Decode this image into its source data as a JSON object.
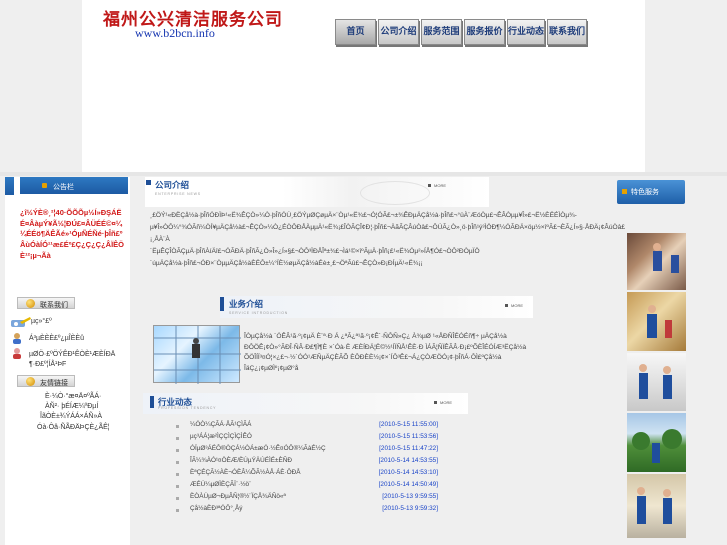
{
  "header": {
    "company_name": "福州公兴清洁服务公司",
    "website": "www.b2bcn.info",
    "nav": [
      {
        "label": "首页"
      },
      {
        "label": "公司介绍"
      },
      {
        "label": "服务范围"
      },
      {
        "label": "服务报价"
      },
      {
        "label": "行业动态"
      },
      {
        "label": "联系我们"
      }
    ]
  },
  "sidebar": {
    "notice_title": "公告栏",
    "notice_text": "¿î½ÝÈ®¸²¦40·ÕÕÕµ½Í»ÐŞÁËÉ¤ÂàµÝ¥Ã½¦ÐÚ£¤ÂÜÉÉ©¤¼¼ÉÉö¶ÄÊÃé»¹ÓµÑÉÑé·þÎñ£ºÂùÓàÍÓ¹¹æ£Éº£Ç¿Ç¿Ç¿ÂÏÊÖÈ¹²¡µ¬Ãà",
    "quick_title": "联系我们",
    "quick_items": [
      {
        "label": "µç»°£º"
      },
      {
        "label": "Á³µÈÈÈ£º¿µÎÈÈû"
      },
      {
        "label": "µØÖ·£ºÖÝÊÐ¹ÊÒÈ¹ÆÈÍÐÄ ¶·Ð£º¦ÍÅ¹ÞF"
      }
    ],
    "links_title": "友情链接",
    "links": [
      {
        "label": "È·¼Ò·°æ¤Ä¤ºÃÁ·"
      },
      {
        "label": "ÀÑ²· þÉÍÆ¼ºÐµÍ"
      },
      {
        "label": "ÎãÒÈ±¾ÝÁÁ×ÁÑ»À"
      },
      {
        "label": "Óà·Ôâ·ÑÃÐÄÞÇÈ¿ÃÊ¦"
      }
    ]
  },
  "about": {
    "title": "公司介绍",
    "subtitle": "ENTERPRISE NEWS",
    "more": "MORE",
    "text": "¸£ÖÝ¹«ÐËÇå½à·þÎñÓÐÏÞ¹«Ë¾ÊÇÒ»¼Ò·þÎñÓÚ¸£ÖÝµØÇøµÄ×¨Òµ¹«Ë¾£¬Ó¦ÓÃ£¬±¾ÊÐµÄÇå½à·þÎñ£¬°üÀ¨ÆóÒµ£¬ÊÂÒµµ¥Î»£¬Ë½ÈËÉÌÒµ¾­µ¥Î»ÒÔ¼°¾ÓÃñ¼ÒÍ¥µÄÇå½à£¬ÊÇÒ»¼Ò¿ÉÒÔÐÅÀµµÄ¹«Ë¾¡£ÎÒÃÇÎ¢Ð¦·þÎñ£¬ÄãÃÇÂúÒâ£¬ÔÚÃ¿Ò»¸ö·þÎñ¹ý³ÌÖÐ¶¼ÓÃÐÄ×öµ½×îºÃ£¬ÈÃ¿Í»§·ÅÐÄ¡¢ÂúÒâ£¡¸ÅÀ¨À´ËµÊÇÎÒÃÇµÄ·þÎñÀíÄî£¬ÓÃÐÄ·þÎñÃ¿Ò»Î»¿Í»§£¬ÒÔ³ÏÐÅÎª±¾£¬Ìá¹©×îºÃµÄ·þÎñ¡£¹«Ë¾Óµ²»ÍÅ¶Ó£¬ÒÔ²ÐÒµÏÖ´úµÄÇå½à·þÎñ£¬ÓÐ×¨ÒµµÄÇå½àÈËÔ±¼°ÏÈ½øµÄÇå½àÉè±¸£¬ÖªÃû£¬ÊÇÒ»Ð¡ÐÍµÄ¹«Ë¾¡­¡­"
  },
  "services": {
    "title": "业务介绍",
    "subtitle": "SERVICE INTRODUCTION",
    "more": "MORE",
    "text": "ÎÒµÇå½à ´ÓÊÂ¹ã·º¡¢µÄ È¨ª·Ð Á  ¿ªÃ¿ª¹ã·º¡¢Ê´·ÑÔ­Ñ»Ç¿ À¾µØ ¹«ÅÐÑÎÉÓÉñ¶÷ µÄÇå½à ÐÔÖÊ¡¢Ò»°ÃÐÎ·ÑÂ·Ð£¶Ì¶È ×´Óà·Ë ÆÈÍÐÄ¦Ë©½¹ÍÏÑÅ¹ÊÈ·Ð ÌÁÃ¦ÑÏÊÃÂ·Ð¡£ºÕÈÎÉÓÍÆ³ËÇå½à ÕÖÎÍÏ³¤Ó¦×¿£¬·½´ÓÓ¹ÆÑµÄÇÈÃÕ ÈÔÐÈÈ½¡¢×´ÍÔ³Ê£¬Á¿ÇÒÆÖÓ¡¢·þÎñÁ·ÔÌ£ºÇå½à ÎäÇ¿¡¢µØÌº¡¢µØ°å"
  },
  "news": {
    "title": "行业动态",
    "subtitle": "PROFESSION TENDENCY",
    "more": "MORE",
    "items": [
      {
        "title": "¼ÓÒ¼ÇÃÁ·ÅÃ¹ÇÌÃÁ",
        "date": "[2010-5-15 11:55:00]"
      },
      {
        "title": "µç³ÁÁ¦æ²ÌÇÇÌÇÌÇÌÊÓ",
        "date": "[2010-5-15 11:53:56]"
      },
      {
        "title": "ÓÏµØ³ÁÉÔ®ÒÇÁ½ÒÁ±æÓ·½Ê¤ÓÔ®¼ÃàÉ½Ç",
        "date": "[2010-5-15 11:47:22]"
      },
      {
        "title": "ÎÃ¼¾ÀÓ¹¤ÖÈÆ/ÈÚµÝÄÚÉÌÉ±ÈÑÐ",
        "date": "[2010-5-14 14:53:55]"
      },
      {
        "title": "ÈªÇÉÇÃ½ÀÈ¬ÓÈÂ¼ÕÃ½ÀÅ·ÁÈ·ÔÐÅ",
        "date": "[2010-5-14 14:53:10]"
      },
      {
        "title": "ÆÉÚ¼µØÏÈÇÃÏ¨·½ö¨",
        "date": "[2010-5-14 14:50:49]"
      },
      {
        "title": "ÈÒÀÚµØ¬ÐµÂÑ¦®½¨ÏÇÅ¾ÄÑö«ª",
        "date": "[2010-5-13 9:59:55]"
      },
      {
        "title": "Çå½àÈÐ³ªÓÔ°¸Åý",
        "date": "[2010-5-13 9:59:32]"
      }
    ]
  },
  "featured": {
    "title": "特色服务"
  }
}
